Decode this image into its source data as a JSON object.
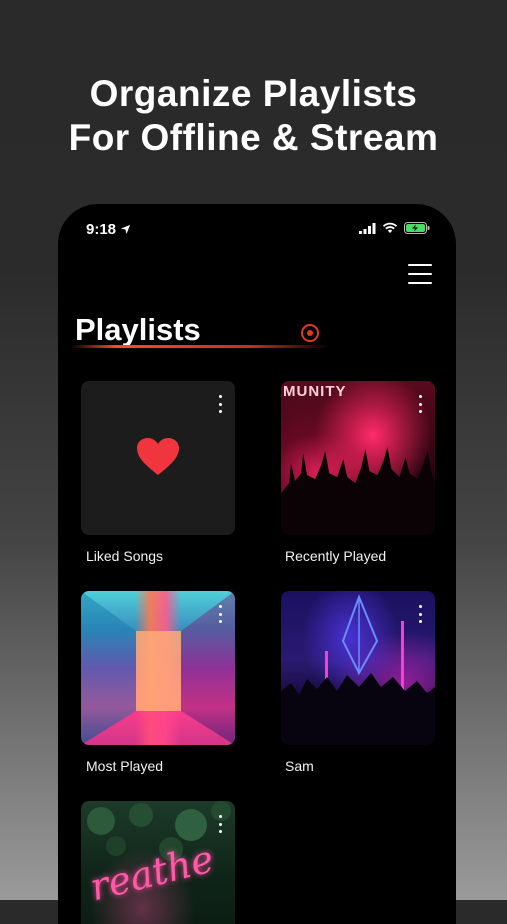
{
  "promo": {
    "line1": "Organize Playlists",
    "line2": "For Offline & Stream"
  },
  "status_bar": {
    "time": "9:18",
    "icons": [
      "location-arrow-icon",
      "signal-icon",
      "wifi-icon",
      "battery-charging-icon"
    ]
  },
  "header": {
    "title": "Playlists",
    "menu_icon": "hamburger-menu-icon"
  },
  "playlists": [
    {
      "label": "Liked Songs",
      "artwork": "heart-icon"
    },
    {
      "label": "Recently Played",
      "artwork_text": "MUNITY"
    },
    {
      "label": "Most Played"
    },
    {
      "label": "Sam"
    },
    {
      "label": "",
      "artwork_text": "reathe"
    }
  ],
  "colors": {
    "accent": "#e03a1e",
    "heart": "#f0353f",
    "background": "#000000"
  }
}
